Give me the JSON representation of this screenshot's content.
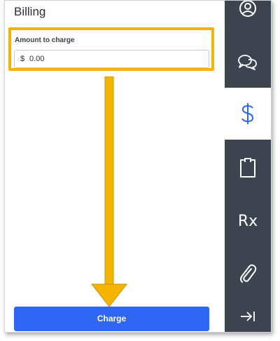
{
  "panel": {
    "title": "Billing"
  },
  "amount_field": {
    "label": "Amount to charge",
    "currency_symbol": "$",
    "value": "0.00"
  },
  "actions": {
    "charge_label": "Charge"
  },
  "sidebar": {
    "items": [
      {
        "icon": "profile-icon"
      },
      {
        "icon": "chat-icon"
      },
      {
        "icon": "dollar-icon",
        "active": true
      },
      {
        "icon": "clipboard-icon"
      },
      {
        "icon": "rx-icon",
        "text": "Rx"
      },
      {
        "icon": "paperclip-icon"
      },
      {
        "icon": "collapse-icon"
      }
    ]
  },
  "colors": {
    "accent": "#2f66f3",
    "highlight": "#f5b400",
    "rail": "#3d4450"
  }
}
